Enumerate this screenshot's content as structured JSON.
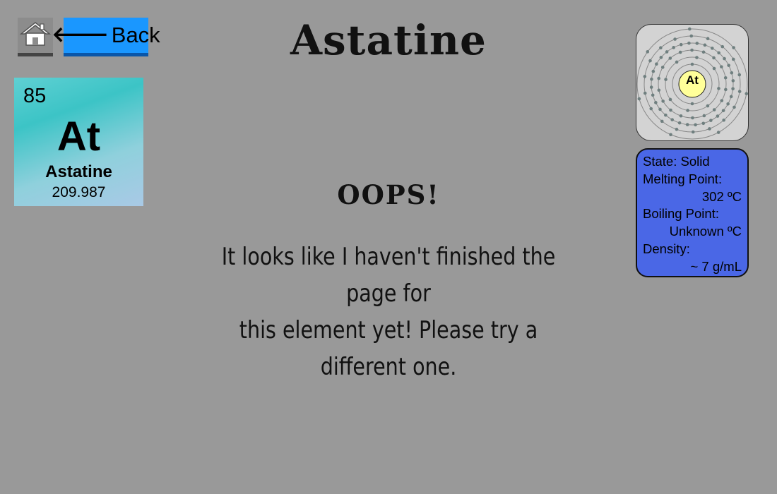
{
  "nav": {
    "back_label": "Back"
  },
  "page_title": "Astatine",
  "tile": {
    "atomic_number": "85",
    "symbol": "At",
    "name": "Astatine",
    "atomic_mass": "209.987"
  },
  "shell_diagram": {
    "nucleus_label": "At",
    "electron_shells": [
      2,
      8,
      18,
      32,
      18,
      7
    ]
  },
  "info": {
    "state": "State: Solid",
    "melting_label": "Melting Point:",
    "melting_value": "302 ºC",
    "boiling_label": "Boiling Point:",
    "boiling_value": "Unknown ºC",
    "density_label": "Density:",
    "density_value": "~ 7 g/mL"
  },
  "message": {
    "heading": "OOPS!",
    "line1": "It looks like I haven't finished the page for",
    "line2": "this element yet! Please try a different one."
  },
  "colors": {
    "background": "#999999",
    "back_button": "#1a97ff",
    "info_box": "#4a67e6",
    "nucleus": "#ffff99"
  }
}
